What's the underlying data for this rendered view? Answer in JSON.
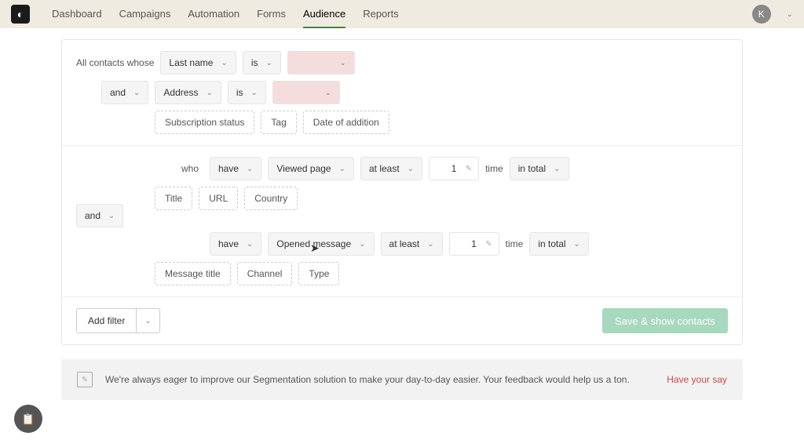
{
  "nav": {
    "items": [
      "Dashboard",
      "Campaigns",
      "Automation",
      "Forms",
      "Audience",
      "Reports"
    ],
    "active": 4
  },
  "avatar": "K",
  "seg": {
    "lead": "All contacts whose",
    "who": "who",
    "time": "time",
    "and": "and",
    "r1": {
      "field": "Last name",
      "op": "is"
    },
    "r2": {
      "field": "Address",
      "op": "is"
    },
    "chips1": [
      "Subscription status",
      "Tag",
      "Date of addition"
    ],
    "w1": {
      "have": "have",
      "what": "Viewed page",
      "cond": "at least",
      "n": "1",
      "scope": "in total"
    },
    "chips2": [
      "Title",
      "URL",
      "Country"
    ],
    "w2": {
      "have": "have",
      "what": "Opened message",
      "cond": "at least",
      "n": "1",
      "scope": "in total"
    },
    "chips3": [
      "Message title",
      "Channel",
      "Type"
    ]
  },
  "add": "Add filter",
  "save": "Save & show contacts",
  "fb": {
    "txt": "We're always eager to improve our Segmentation solution to make your day-to-day easier. Your feedback would help us a ton.",
    "link": "Have your say"
  }
}
